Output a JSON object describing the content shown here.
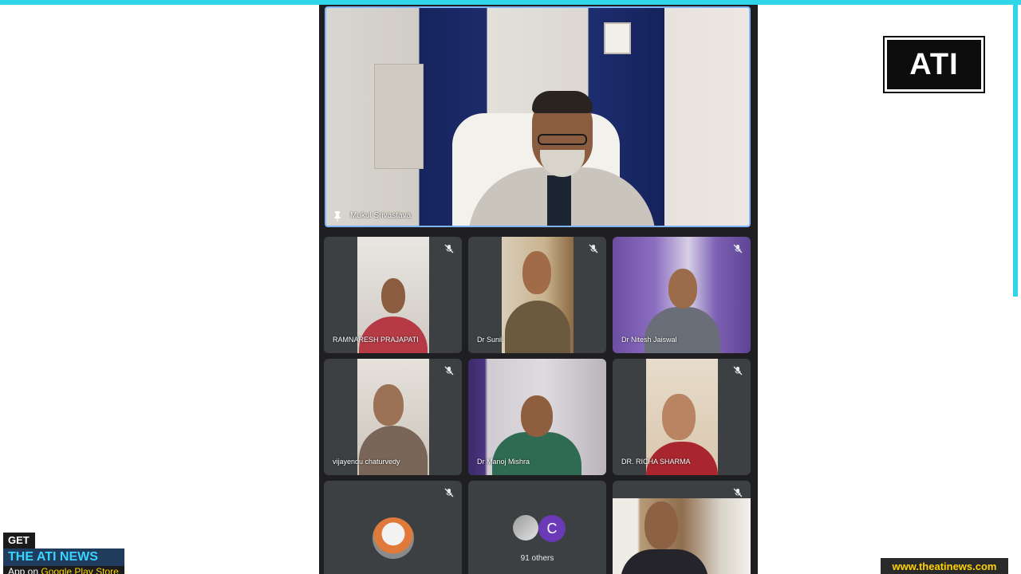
{
  "brand": {
    "logo_text": "ATI"
  },
  "main_speaker": {
    "name": "Mukul Srivastava",
    "pin_icon": "pin-icon"
  },
  "participants": [
    {
      "name": "RAMNARESH PRAJAPATI",
      "muted": true
    },
    {
      "name": "Dr Sunil",
      "muted": true
    },
    {
      "name": "Dr Nitesh Jaiswal",
      "muted": true
    },
    {
      "name": "vijayendu chaturvedy",
      "muted": true
    },
    {
      "name": "Dr Manoj Mishra",
      "muted": false
    },
    {
      "name": "DR. RICHA SHARMA",
      "muted": true
    }
  ],
  "others_tile": {
    "avatar_letter": "C",
    "label": "91 others"
  },
  "promo": {
    "get_label": "GET",
    "app_name": "THE ATI NEWS",
    "store_prefix": "App on ",
    "store_name": "Google Play Store"
  },
  "website": "www.theatinews.com",
  "colors": {
    "accent_cyan": "#2fd6ea",
    "tile_bg": "#3c4043",
    "avatar_purple": "#6a3ab7",
    "active_border": "#7fb5ff"
  }
}
